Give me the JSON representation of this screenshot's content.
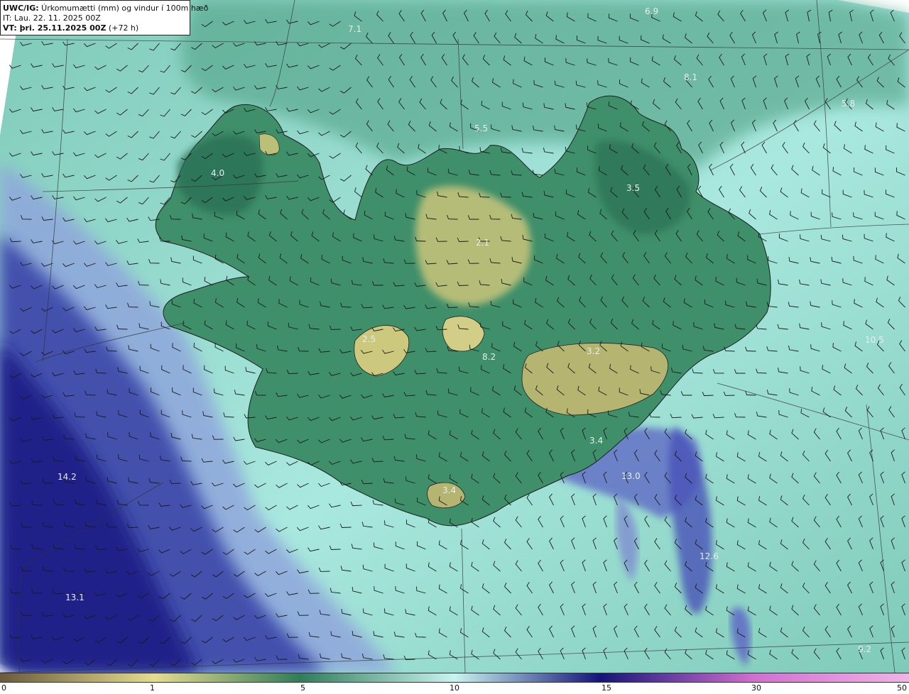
{
  "header": {
    "title_bold": "UWC/IG:",
    "title_rest": " Úrkomumætti (mm) og vindur í 100m hæð",
    "init_time": "IT: Lau. 22. 11. 2025 00Z",
    "valid_bold": "VT: þri. 25.11.2025 00Z",
    "valid_rest": " (+72 h)"
  },
  "map_labels": [
    {
      "id": "val-6-9",
      "text": "6.9"
    },
    {
      "id": "val-7-1",
      "text": "7.1"
    },
    {
      "id": "val-8-1",
      "text": "8.1"
    },
    {
      "id": "val-5-8",
      "text": "5.8"
    },
    {
      "id": "val-5-5",
      "text": "5.5"
    },
    {
      "id": "val-4-0",
      "text": "4.0"
    },
    {
      "id": "val-3-5",
      "text": "3.5"
    },
    {
      "id": "val-2-1",
      "text": "2.1"
    },
    {
      "id": "val-2-5",
      "text": "2.5"
    },
    {
      "id": "val-8-2",
      "text": "8.2"
    },
    {
      "id": "val-3-2",
      "text": "3.2"
    },
    {
      "id": "val-10-5",
      "text": "10.5"
    },
    {
      "id": "val-3-4a",
      "text": "3.4"
    },
    {
      "id": "val-3-4b",
      "text": "3.4"
    },
    {
      "id": "val-13-0",
      "text": "13.0"
    },
    {
      "id": "val-14-2",
      "text": "14.2"
    },
    {
      "id": "val-12-6",
      "text": "12.6"
    },
    {
      "id": "val-13-1",
      "text": "13.1"
    },
    {
      "id": "val-9-2",
      "text": "9.2"
    }
  ],
  "colorbar": {
    "ticks": [
      "0",
      "1",
      "5",
      "10",
      "15",
      "30",
      "50"
    ],
    "colors": {
      "c0": "#6b5a3c",
      "c1": "#e6dc8c",
      "c5": "#2f7d5a",
      "c10": "#c8f4f0",
      "c15": "#14147a",
      "c30": "#d26ed2",
      "c50": "#f0b4e6"
    }
  },
  "map_colors": {
    "ocean_light": "#a9e8df",
    "ocean_mid": "#7fcab8",
    "land_green": "#3f8f6a",
    "land_dark": "#2c6f55",
    "land_yellow": "#c9c57a",
    "precip_blue": "#2a2f9a",
    "precip_navy": "#141a7a",
    "precip_lilac": "#8f95d8"
  }
}
